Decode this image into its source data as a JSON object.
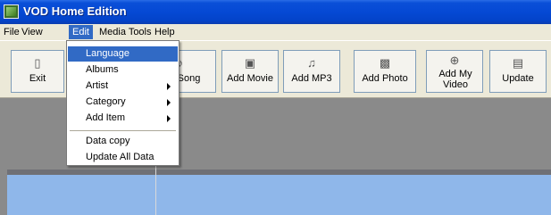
{
  "window": {
    "title": "VOD Home Edition",
    "icon": "vod-app-icon"
  },
  "menubar": {
    "items": [
      "File",
      "View",
      "Edit",
      "Media Tools",
      "Help"
    ],
    "active": "Edit"
  },
  "toolbar": {
    "buttons": [
      {
        "label": "Exit",
        "icon": "exit-door-icon"
      },
      {
        "label": "Song",
        "icon": "song-icon"
      },
      {
        "label": "Add Movie",
        "icon": "movie-icon"
      },
      {
        "label": "Add MP3",
        "icon": "mp3-icon"
      },
      {
        "label": "Add Photo",
        "icon": "photo-icon"
      },
      {
        "label": "Add My Video",
        "icon": "my-video-icon"
      },
      {
        "label": "Update",
        "icon": "update-icon"
      }
    ]
  },
  "edit_menu": {
    "items": [
      {
        "label": "Language",
        "submenu": false,
        "highlighted": true
      },
      {
        "label": "Albums",
        "submenu": false
      },
      {
        "label": "Artist",
        "submenu": true
      },
      {
        "label": "Category",
        "submenu": true
      },
      {
        "label": "Add Item",
        "submenu": true
      },
      {
        "label": "Data copy",
        "submenu": false
      },
      {
        "label": "Update All Data",
        "submenu": false
      }
    ]
  }
}
